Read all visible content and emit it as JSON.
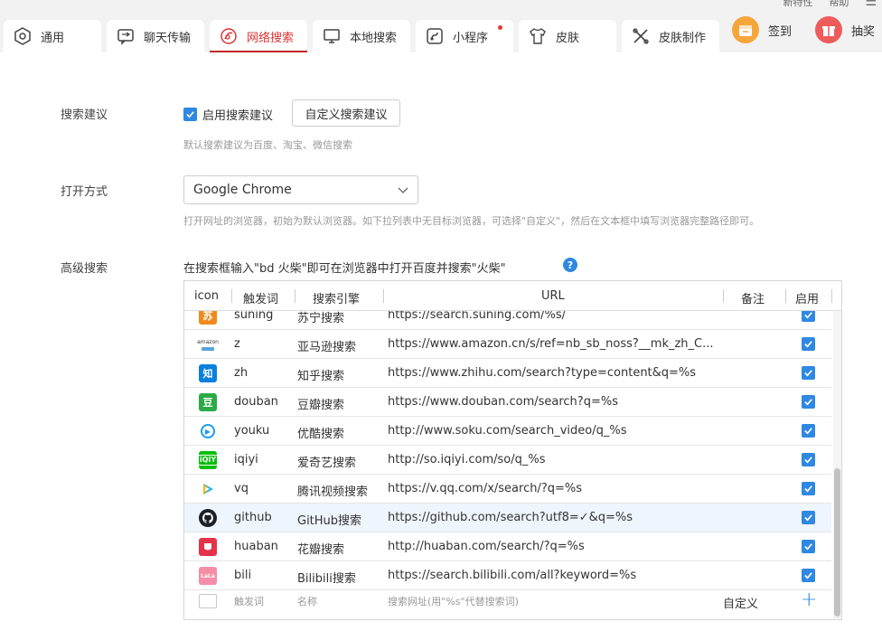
{
  "top_menu": {
    "items": [
      "新特性",
      "帮助"
    ]
  },
  "tabs": [
    {
      "label": "通用",
      "icon": "hexagon-icon"
    },
    {
      "label": "聊天传输",
      "icon": "chat-transfer-icon"
    },
    {
      "label": "网络搜索",
      "icon": "web-search-icon",
      "active": true
    },
    {
      "label": "本地搜索",
      "icon": "monitor-icon"
    },
    {
      "label": "小程序",
      "icon": "mini-app-icon",
      "badge": true
    },
    {
      "label": "皮肤",
      "icon": "tshirt-icon"
    },
    {
      "label": "皮肤制作",
      "icon": "tools-icon"
    }
  ],
  "promo": {
    "checkin_label": "签到",
    "lottery_label": "抽奖"
  },
  "settings": {
    "search_suggest": {
      "label": "搜索建议",
      "checkbox_label": "启用搜索建议",
      "checked": true,
      "custom_button": "自定义搜索建议",
      "hint": "默认搜索建议为百度、淘宝、微信搜索"
    },
    "open_mode": {
      "label": "打开方式",
      "selected": "Google Chrome",
      "hint": "打开网址的浏览器，初始为默认浏览器。如下拉列表中无目标浏览器，可选择\"自定义\"，然后在文本框中填写浏览器完整路径即可。"
    },
    "advanced": {
      "label": "高级搜索",
      "description": "在搜索框输入\"bd 火柴\"即可在浏览器中打开百度并搜索\"火柴\"",
      "help": "?"
    }
  },
  "table": {
    "headers": [
      "icon",
      "触发词",
      "搜索引擎",
      "URL",
      "备注",
      "启用"
    ],
    "rows": [
      {
        "icon": "suning-icon",
        "icon_color": "#f08a1c",
        "icon_text": "苏",
        "trigger": "suning",
        "name": "苏宁搜索",
        "url": "https://search.suning.com/%s/",
        "enabled": true
      },
      {
        "icon": "amazon-icon",
        "icon_color": "#ffffff",
        "icon_text": "amazon",
        "trigger": "z",
        "name": "亚马逊搜索",
        "url": "https://www.amazon.cn/s/ref=nb_sb_noss?__mk_zh_C...",
        "enabled": true
      },
      {
        "icon": "zhihu-icon",
        "icon_color": "#0a7fdd",
        "icon_text": "知",
        "trigger": "zh",
        "name": "知乎搜索",
        "url": "https://www.zhihu.com/search?type=content&q=%s",
        "enabled": true
      },
      {
        "icon": "douban-icon",
        "icon_color": "#2bab46",
        "icon_text": "豆",
        "trigger": "douban",
        "name": "豆瓣搜索",
        "url": "https://www.douban.com/search?q=%s",
        "enabled": true
      },
      {
        "icon": "youku-icon",
        "icon_color": "#ffffff",
        "icon_text": "▶",
        "trigger": "youku",
        "name": "优酷搜索",
        "url": "http://www.soku.com/search_video/q_%s",
        "enabled": true
      },
      {
        "icon": "iqiyi-icon",
        "icon_color": "#00be06",
        "icon_text": "iQ",
        "trigger": "iqiyi",
        "name": "爱奇艺搜索",
        "url": "http://so.iqiyi.com/so/q_%s",
        "enabled": true
      },
      {
        "icon": "tencent-video-icon",
        "icon_color": "#ffffff",
        "icon_text": "▶",
        "trigger": "vq",
        "name": "腾讯视频搜索",
        "url": "https://v.qq.com/x/search/?q=%s",
        "enabled": true
      },
      {
        "icon": "github-icon",
        "icon_color": "#1b1f23",
        "icon_text": "",
        "trigger": "github",
        "name": "GitHub搜索",
        "url": "https://github.com/search?utf8=✓&q=%s",
        "enabled": true,
        "highlight": true
      },
      {
        "icon": "huaban-icon",
        "icon_color": "#e4324a",
        "icon_text": "",
        "trigger": "huaban",
        "name": "花瓣搜索",
        "url": "http://huaban.com/search/?q=%s",
        "enabled": true
      },
      {
        "icon": "bilibili-icon",
        "icon_color": "#f58da6",
        "icon_text": "LaLa",
        "trigger": "bili",
        "name": "Bilibili搜索",
        "url": "https://search.bilibili.com/all?keyword=%s",
        "enabled": true
      }
    ],
    "new_row": {
      "trigger_placeholder": "触发词",
      "name_placeholder": "名称",
      "url_placeholder": "搜索网址(用\"%s\"代替搜索词)",
      "custom_label": "自定义",
      "add": "+"
    }
  },
  "colors": {
    "accent": "#c0262b",
    "blue": "#2f88e2"
  }
}
